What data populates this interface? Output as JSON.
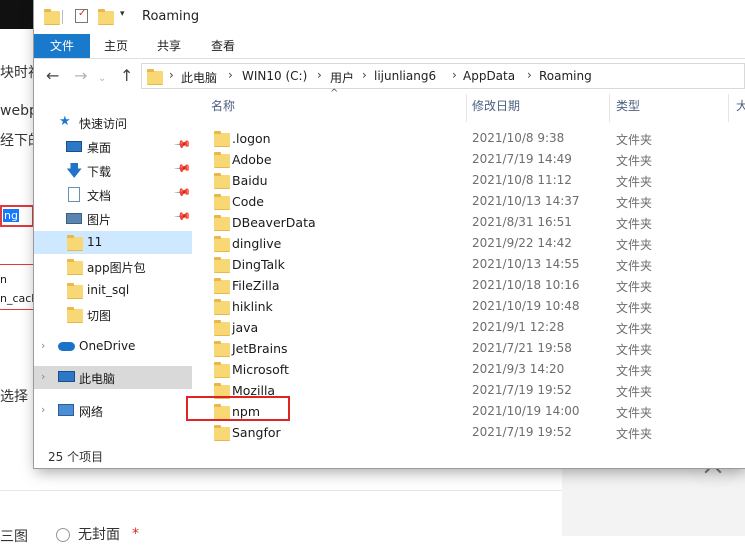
{
  "background": {
    "fragments": [
      "块时视",
      "webp",
      "经下的",
      "选择"
    ],
    "input_text": "ng",
    "box_lines": [
      "n",
      "n_cach"
    ],
    "bottom_left": "三图",
    "radio_label": "无封面",
    "required_mark": "*"
  },
  "window": {
    "title": "Roaming",
    "ribbon_tabs": [
      "文件",
      "主页",
      "共享",
      "查看"
    ]
  },
  "address": {
    "crumbs": [
      "此电脑",
      "WIN10 (C:)",
      "用户",
      "lijunliang6",
      "AppData",
      "Roaming"
    ]
  },
  "nav": {
    "quick_access": "快速访问",
    "items": [
      {
        "label": "桌面",
        "icon": "desktop-icon",
        "pinned": true
      },
      {
        "label": "下载",
        "icon": "download-icon",
        "pinned": true
      },
      {
        "label": "文档",
        "icon": "document-icon",
        "pinned": true
      },
      {
        "label": "图片",
        "icon": "picture-icon",
        "pinned": true
      },
      {
        "label": "11",
        "icon": "folder-icon",
        "pinned": false
      },
      {
        "label": "app图片包",
        "icon": "folder-icon",
        "pinned": false
      },
      {
        "label": "init_sql",
        "icon": "folder-icon",
        "pinned": false
      },
      {
        "label": "切图",
        "icon": "folder-icon",
        "pinned": false
      }
    ],
    "onedrive": "OneDrive",
    "this_pc": "此电脑",
    "network": "网络"
  },
  "columns": {
    "name": "名称",
    "date": "修改日期",
    "type": "类型",
    "size": "大"
  },
  "files": [
    {
      "name": ".logon",
      "date": "2021/10/8 9:38",
      "type": "文件夹"
    },
    {
      "name": "Adobe",
      "date": "2021/7/19 14:49",
      "type": "文件夹"
    },
    {
      "name": "Baidu",
      "date": "2021/10/8 11:12",
      "type": "文件夹"
    },
    {
      "name": "Code",
      "date": "2021/10/13 14:37",
      "type": "文件夹"
    },
    {
      "name": "DBeaverData",
      "date": "2021/8/31 16:51",
      "type": "文件夹"
    },
    {
      "name": "dinglive",
      "date": "2021/9/22 14:42",
      "type": "文件夹"
    },
    {
      "name": "DingTalk",
      "date": "2021/10/13 14:55",
      "type": "文件夹"
    },
    {
      "name": "FileZilla",
      "date": "2021/10/18 10:16",
      "type": "文件夹"
    },
    {
      "name": "hiklink",
      "date": "2021/10/19 10:48",
      "type": "文件夹"
    },
    {
      "name": "java",
      "date": "2021/9/1 12:28",
      "type": "文件夹"
    },
    {
      "name": "JetBrains",
      "date": "2021/7/21 19:58",
      "type": "文件夹"
    },
    {
      "name": "Microsoft",
      "date": "2021/9/3 14:20",
      "type": "文件夹"
    },
    {
      "name": "Mozilla",
      "date": "2021/7/19 19:52",
      "type": "文件夹"
    },
    {
      "name": "npm",
      "date": "2021/10/19 14:00",
      "type": "文件夹"
    },
    {
      "name": "Sangfor",
      "date": "2021/7/19 19:52",
      "type": "文件夹"
    }
  ],
  "status": {
    "count": "25 个项目"
  }
}
